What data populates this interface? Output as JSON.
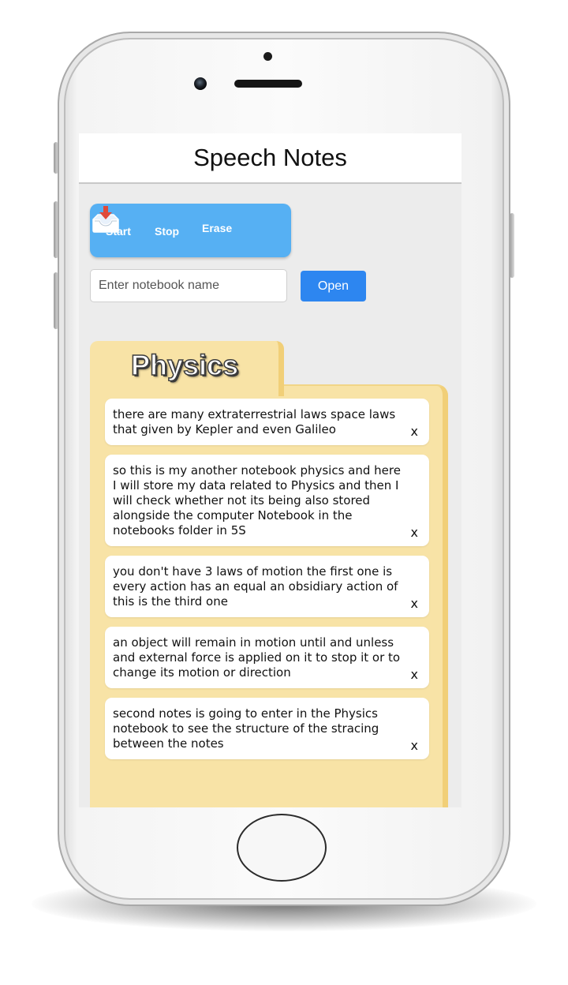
{
  "app": {
    "title": "Speech Notes"
  },
  "toolbar": {
    "start_label": "Start",
    "stop_label": "Stop",
    "erase_label": "Erase",
    "save_icon": "save-to-tray-icon"
  },
  "notebook": {
    "input_placeholder": "Enter notebook name",
    "input_value": "",
    "open_label": "Open",
    "current_name": "Physics"
  },
  "notes": [
    {
      "text": "there are many extraterrestrial laws space laws that given by Kepler and even Galileo",
      "delete_label": "x"
    },
    {
      "text": "so this is my another notebook physics and here I will store my data related to Physics and then I will check whether not its being also stored alongside the computer Notebook in the notebooks folder in 5S",
      "delete_label": "x"
    },
    {
      "text": "you don't have 3 laws of motion the first one is every action has an equal an obsidiary action of this is the third one",
      "delete_label": "x"
    },
    {
      "text": "an object will remain in motion until and unless and external force is applied on it to stop it or to change its motion or direction",
      "delete_label": "x"
    },
    {
      "text": "second notes is going to enter in the Physics notebook to see the structure of the stracing between the notes",
      "delete_label": "x"
    }
  ],
  "colors": {
    "toolbar": "#56b0f3",
    "open_button": "#2d86f0",
    "folder": "#f8e3a6",
    "folder_edge": "#f1cf78",
    "screen_bg": "#ececec"
  }
}
